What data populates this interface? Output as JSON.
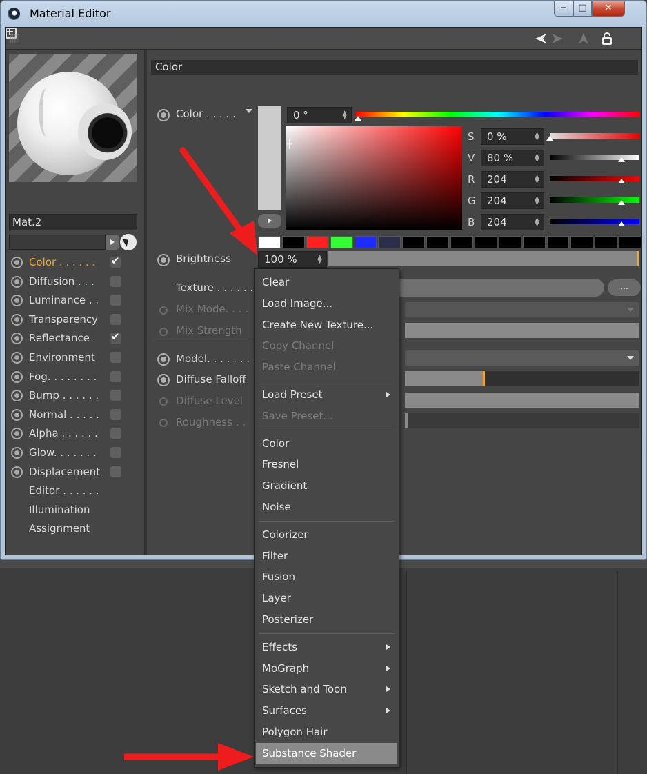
{
  "window": {
    "title": "Material Editor"
  },
  "material": {
    "name": "Mat.2"
  },
  "channels": [
    {
      "label": "Color . . . . . .",
      "checked": true,
      "active": true,
      "has_check": true
    },
    {
      "label": "Diffusion . . .",
      "checked": false,
      "has_check": true
    },
    {
      "label": "Luminance . .",
      "checked": false,
      "has_check": true
    },
    {
      "label": "Transparency",
      "checked": false,
      "has_check": true
    },
    {
      "label": "Reflectance",
      "checked": true,
      "has_check": true
    },
    {
      "label": "Environment",
      "checked": false,
      "has_check": true
    },
    {
      "label": "Fog. . . . . . . .",
      "checked": false,
      "has_check": true
    },
    {
      "label": "Bump . . . . . .",
      "checked": false,
      "has_check": true
    },
    {
      "label": "Normal . . . . .",
      "checked": false,
      "has_check": true
    },
    {
      "label": "Alpha . . . . . .",
      "checked": false,
      "has_check": true
    },
    {
      "label": "Glow. . . . . . .",
      "checked": false,
      "has_check": true
    },
    {
      "label": "Displacement",
      "checked": false,
      "has_check": true
    },
    {
      "label": "Editor . . . . . .",
      "has_check": false,
      "no_radio": true
    },
    {
      "label": "Illumination",
      "has_check": false,
      "no_radio": true
    },
    {
      "label": "Assignment",
      "has_check": false,
      "no_radio": true
    }
  ],
  "section": {
    "title": "Color"
  },
  "color": {
    "label": "Color . . . . .",
    "hue": "0 °",
    "s": {
      "letter": "S",
      "value": "0 %",
      "level": 0.0
    },
    "v": {
      "letter": "V",
      "value": "80 %",
      "level": 0.8
    },
    "r": {
      "letter": "R",
      "value": "204",
      "level": 0.8
    },
    "g": {
      "letter": "G",
      "value": "204",
      "level": 0.8
    },
    "b": {
      "letter": "B",
      "value": "204",
      "level": 0.8
    },
    "swatch": "#cccccc",
    "presets": [
      "#ffffff",
      "#000000",
      "#ff2020",
      "#33ff33",
      "#1e2cff",
      "#2a2e4a",
      "#000000",
      "#000000",
      "#000000",
      "#000000",
      "#000000",
      "#000000",
      "#000000",
      "#000000",
      "#000000",
      "#000000"
    ]
  },
  "brightness": {
    "label": "Brightness",
    "value": "100 %"
  },
  "texture": {
    "label": "Texture . . . . . .",
    "more": "..."
  },
  "mix": {
    "mode_label": "Mix Mode. . . .",
    "strength_label": "Mix Strength"
  },
  "model": {
    "label": "Model. . . . . . .",
    "falloff_label": "Diffuse Falloff",
    "level_label": "Diffuse Level",
    "roughness_label": "Roughness . ."
  },
  "menu": {
    "items": [
      {
        "label": "Clear"
      },
      {
        "label": "Load Image..."
      },
      {
        "label": "Create New Texture..."
      },
      {
        "label": "Copy Channel",
        "disabled": true
      },
      {
        "label": "Paste Channel",
        "disabled": true
      },
      {
        "sep": true
      },
      {
        "label": "Load Preset",
        "submenu": true
      },
      {
        "label": "Save Preset...",
        "disabled": true
      },
      {
        "sep": true
      },
      {
        "label": "Color"
      },
      {
        "label": "Fresnel"
      },
      {
        "label": "Gradient"
      },
      {
        "label": "Noise"
      },
      {
        "sep": true
      },
      {
        "label": "Colorizer"
      },
      {
        "label": "Filter"
      },
      {
        "label": "Fusion"
      },
      {
        "label": "Layer"
      },
      {
        "label": "Posterizer"
      },
      {
        "sep": true
      },
      {
        "label": "Effects",
        "submenu": true
      },
      {
        "label": "MoGraph",
        "submenu": true
      },
      {
        "label": "Sketch and Toon",
        "submenu": true
      },
      {
        "label": "Surfaces",
        "submenu": true
      },
      {
        "label": "Polygon Hair"
      },
      {
        "label": "Substance Shader",
        "highlighted": true
      }
    ]
  },
  "icons": {
    "toolbar": [
      "grip-icon",
      "back-arrow-icon",
      "forward-arrow-icon",
      "up-arrow-icon",
      "lock-icon",
      "new-window-icon"
    ]
  },
  "colors": {
    "accent": "#f5a623",
    "annotation": "#ee1c1c"
  }
}
